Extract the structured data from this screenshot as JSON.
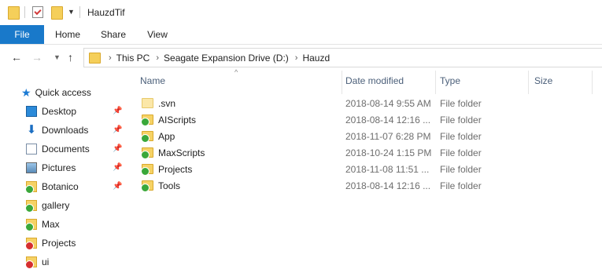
{
  "window": {
    "title": "HauzdTif"
  },
  "ribbon": {
    "tabs": [
      {
        "label": "File"
      },
      {
        "label": "Home"
      },
      {
        "label": "Share"
      },
      {
        "label": "View"
      }
    ]
  },
  "address": {
    "crumbs": [
      "This PC",
      "Seagate Expansion Drive (D:)",
      "Hauzd"
    ]
  },
  "sidebar": {
    "quick_access": "Quick access",
    "items": [
      {
        "label": "Desktop",
        "icon": "desktop-icon",
        "pinned": true
      },
      {
        "label": "Downloads",
        "icon": "downloads-icon",
        "pinned": true
      },
      {
        "label": "Documents",
        "icon": "documents-icon",
        "pinned": true
      },
      {
        "label": "Pictures",
        "icon": "pictures-icon",
        "pinned": true
      },
      {
        "label": "Botanico",
        "icon": "folder-ok-icon",
        "pinned": true
      },
      {
        "label": "gallery",
        "icon": "folder-ok-icon",
        "pinned": false
      },
      {
        "label": "Max",
        "icon": "folder-ok-icon",
        "pinned": false
      },
      {
        "label": "Projects",
        "icon": "folder-error-icon",
        "pinned": false
      },
      {
        "label": "ui",
        "icon": "folder-error-icon",
        "pinned": false
      }
    ]
  },
  "columns": {
    "name": "Name",
    "date": "Date modified",
    "type": "Type",
    "size": "Size"
  },
  "files": [
    {
      "name": ".svn",
      "date": "2018-08-14 9:55 AM",
      "type": "File folder",
      "status": "none"
    },
    {
      "name": "AIScripts",
      "date": "2018-08-14 12:16 ...",
      "type": "File folder",
      "status": "ok"
    },
    {
      "name": "App",
      "date": "2018-11-07 6:28 PM",
      "type": "File folder",
      "status": "ok"
    },
    {
      "name": "MaxScripts",
      "date": "2018-10-24 1:15 PM",
      "type": "File folder",
      "status": "ok"
    },
    {
      "name": "Projects",
      "date": "2018-11-08 11:51 ...",
      "type": "File folder",
      "status": "ok"
    },
    {
      "name": "Tools",
      "date": "2018-08-14 12:16 ...",
      "type": "File folder",
      "status": "ok"
    }
  ],
  "colors": {
    "file_tab": "#1979ca",
    "ok_badge": "#3aa83a",
    "error_badge": "#d62f2f",
    "column_header": "#4c607a"
  }
}
